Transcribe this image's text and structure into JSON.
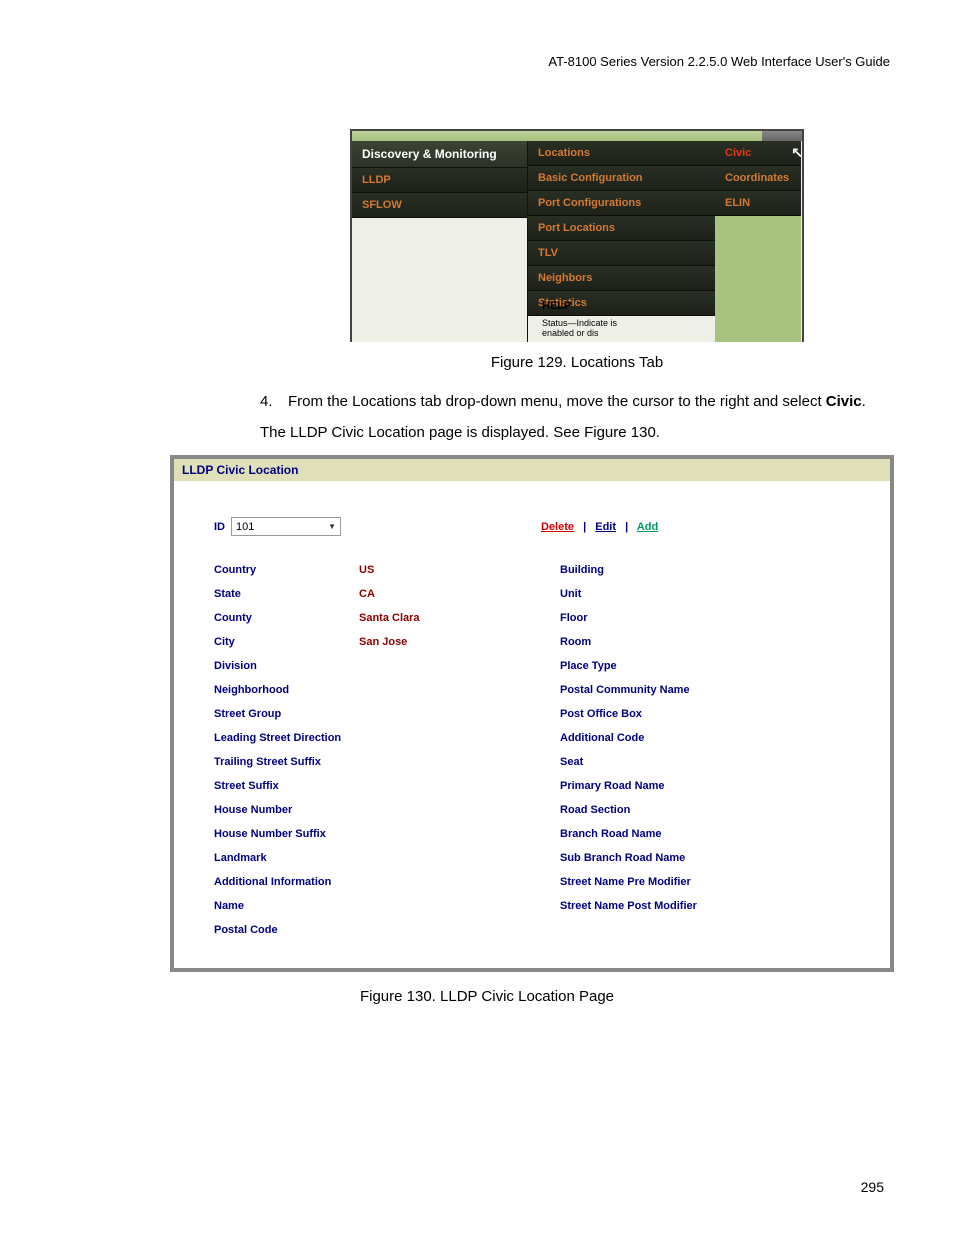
{
  "doc_header": "AT-8100 Series Version 2.2.5.0 Web Interface User's Guide",
  "page_number": "295",
  "fig129": {
    "section_header": "Discovery & Monitoring",
    "col1_items": [
      "LLDP",
      "SFLOW"
    ],
    "col2_items": [
      "Locations",
      "Basic Configuration",
      "Port Configurations",
      "Port Locations",
      "TLV",
      "Neighbors",
      "Statistics"
    ],
    "col3_items": [
      "Civic",
      "Coordinates",
      "ELIN"
    ],
    "help_heading": "HELP",
    "help_text": "Status—Indicate is enabled or dis",
    "caption": "Figure 129. Locations Tab"
  },
  "step": {
    "num": "4.",
    "text_a": "From the Locations tab drop-down menu, move the cursor to the right and select ",
    "text_b": "Civic",
    "text_c": "."
  },
  "paragraph": "The LLDP Civic Location page is displayed. See Figure 130.",
  "fig130": {
    "title": "LLDP Civic Location",
    "id_label": "ID",
    "id_value": "101",
    "actions": {
      "delete": "Delete",
      "edit": "Edit",
      "add": "Add"
    },
    "left_fields": [
      {
        "label": "Country",
        "value": "US"
      },
      {
        "label": "State",
        "value": "CA"
      },
      {
        "label": "County",
        "value": "Santa Clara"
      },
      {
        "label": "City",
        "value": "San Jose"
      },
      {
        "label": "Division",
        "value": ""
      },
      {
        "label": "Neighborhood",
        "value": ""
      },
      {
        "label": "Street Group",
        "value": ""
      },
      {
        "label": "Leading Street Direction",
        "value": ""
      },
      {
        "label": "Trailing Street Suffix",
        "value": ""
      },
      {
        "label": "Street Suffix",
        "value": ""
      },
      {
        "label": "House Number",
        "value": ""
      },
      {
        "label": "House Number Suffix",
        "value": ""
      },
      {
        "label": "Landmark",
        "value": ""
      },
      {
        "label": "Additional Information",
        "value": ""
      },
      {
        "label": "Name",
        "value": ""
      },
      {
        "label": "Postal Code",
        "value": ""
      }
    ],
    "right_fields": [
      {
        "label": "Building",
        "value": ""
      },
      {
        "label": "Unit",
        "value": ""
      },
      {
        "label": "Floor",
        "value": ""
      },
      {
        "label": "Room",
        "value": ""
      },
      {
        "label": "Place Type",
        "value": ""
      },
      {
        "label": "Postal Community Name",
        "value": ""
      },
      {
        "label": "Post Office Box",
        "value": ""
      },
      {
        "label": "Additional Code",
        "value": ""
      },
      {
        "label": "Seat",
        "value": ""
      },
      {
        "label": "Primary Road Name",
        "value": ""
      },
      {
        "label": "Road Section",
        "value": ""
      },
      {
        "label": "Branch Road Name",
        "value": ""
      },
      {
        "label": "Sub Branch Road Name",
        "value": ""
      },
      {
        "label": "Street Name Pre Modifier",
        "value": ""
      },
      {
        "label": "Street Name Post Modifier",
        "value": ""
      }
    ],
    "caption": "Figure 130. LLDP Civic Location Page"
  }
}
